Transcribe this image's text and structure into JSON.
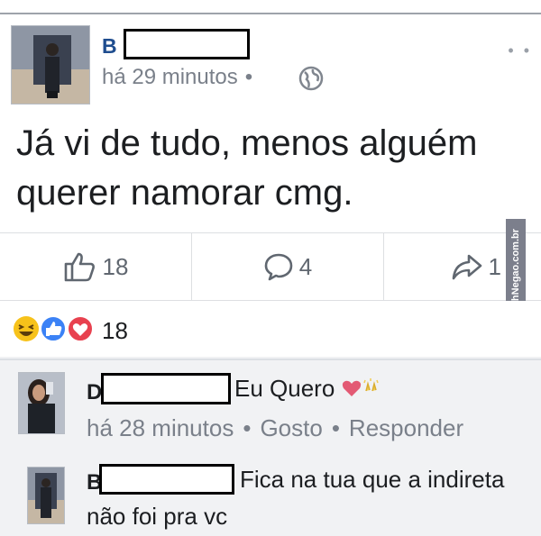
{
  "post": {
    "author_initial": "B",
    "time": "há 29 minutos",
    "time_dot": "•",
    "text_line1": "Já vi de tudo, menos alguém",
    "text_line2": "querer namorar cmg.",
    "like_count": "18",
    "comment_count": "4",
    "share_count": "1",
    "reaction_total": "18",
    "options_glyph": "• •",
    "icons": [
      "globe-icon",
      "thumbs-up-icon",
      "comment-icon",
      "share-icon",
      "haha-reaction-icon",
      "like-reaction-icon",
      "love-reaction-icon"
    ]
  },
  "watermark": "AhNegao.com.br",
  "comments": [
    {
      "author_initial": "D",
      "text": "Eu Quero",
      "emojis": [
        "heart",
        "raised-hands"
      ],
      "time": "há 28 minutos",
      "like_action": "Gosto",
      "reply_action": "Responder",
      "meta_dot": "•"
    },
    {
      "author_initial": "B",
      "text_line1": "Fica na tua que a indireta",
      "text_line2": "não foi pra vc"
    }
  ],
  "colors": {
    "author_blue": "#1f4d8f",
    "meta_gray": "#7a808a",
    "haha": "#f7c21a",
    "like": "#3b82f6",
    "love": "#e8414f"
  }
}
